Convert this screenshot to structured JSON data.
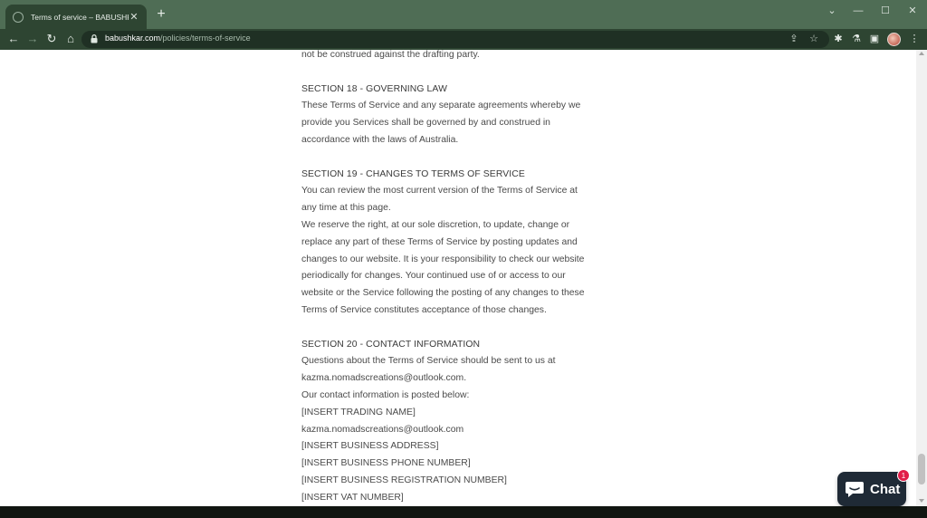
{
  "browser": {
    "tab_title": "Terms of service – BABUSHKAR",
    "url_host": "babushkar.com",
    "url_path": "/policies/terms-of-service",
    "accent_color": "#4f6d55"
  },
  "icons": {
    "new_tab": "+",
    "back": "←",
    "forward": "→",
    "reload": "↻",
    "home": "⌂",
    "close": "✕",
    "minimize": "—",
    "maximize": "☐",
    "dropdown": "⌄",
    "share": "⇪",
    "star": "☆",
    "extensions": "✱",
    "labs": "⚗",
    "sidepanel": "▣",
    "menu": "⋮"
  },
  "content": {
    "intro_tail": "not be construed against the drafting party.",
    "s18_heading": "SECTION 18 - GOVERNING LAW",
    "s18_lines": [
      "These Terms of Service and any separate agreements whereby we",
      "provide you Services shall be governed by and construed in",
      "accordance with the laws of Australia."
    ],
    "s19_heading": "SECTION 19 - CHANGES TO TERMS OF SERVICE",
    "s19_lines": [
      "You can review the most current version of the Terms of Service at",
      "any time at this page.",
      "We reserve the right, at our sole discretion, to update, change or",
      "replace any part of these Terms of Service by posting updates and",
      "changes to our website. It is your responsibility to check our website",
      "periodically for changes. Your continued use of or access to our",
      "website or the Service following the posting of any changes to these",
      "Terms of Service constitutes acceptance of those changes."
    ],
    "s20_heading": "SECTION 20 - CONTACT INFORMATION",
    "s20_lines": [
      "Questions about the Terms of Service should be sent to us at",
      "kazma.nomadscreations@outlook.com.",
      "Our contact information is posted below:",
      "[INSERT TRADING NAME]",
      "kazma.nomadscreations@outlook.com",
      "[INSERT BUSINESS ADDRESS]",
      "[INSERT BUSINESS PHONE NUMBER]",
      "[INSERT BUSINESS REGISTRATION NUMBER]",
      "[INSERT VAT NUMBER]"
    ]
  },
  "chat": {
    "label": "Chat",
    "badge_count": "1",
    "bg_color": "#1f2a36",
    "badge_color": "#e11d48"
  }
}
